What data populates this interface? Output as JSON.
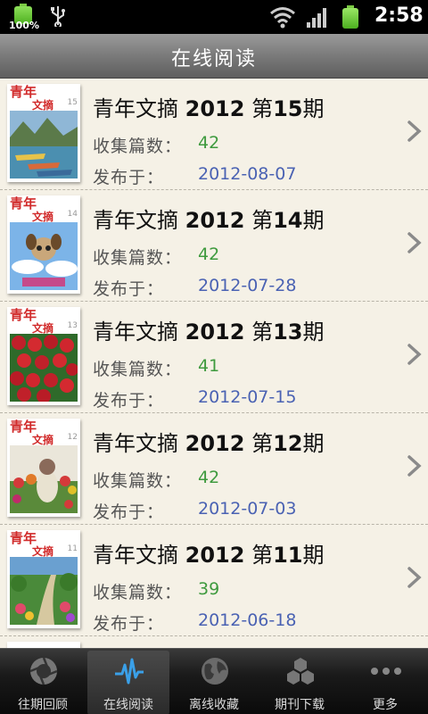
{
  "status_bar": {
    "battery_percent": "100%",
    "time": "2:58",
    "icons": [
      "battery-icon",
      "usb-icon",
      "wifi-icon",
      "signal-icon",
      "battery-icon"
    ]
  },
  "header": {
    "title": "在线阅读"
  },
  "list": {
    "count_label": "收集篇数：",
    "date_label": "发布于：",
    "items": [
      {
        "mag_name": "青年文摘",
        "year": "2012",
        "issue_prefix": "第",
        "issue": "15",
        "issue_suffix": "期",
        "count": "42",
        "date": "2012-08-07"
      },
      {
        "mag_name": "青年文摘",
        "year": "2012",
        "issue_prefix": "第",
        "issue": "14",
        "issue_suffix": "期",
        "count": "42",
        "date": "2012-07-28"
      },
      {
        "mag_name": "青年文摘",
        "year": "2012",
        "issue_prefix": "第",
        "issue": "13",
        "issue_suffix": "期",
        "count": "41",
        "date": "2012-07-15"
      },
      {
        "mag_name": "青年文摘",
        "year": "2012",
        "issue_prefix": "第",
        "issue": "12",
        "issue_suffix": "期",
        "count": "42",
        "date": "2012-07-03"
      },
      {
        "mag_name": "青年文摘",
        "year": "2012",
        "issue_prefix": "第",
        "issue": "11",
        "issue_suffix": "期",
        "count": "39",
        "date": "2012-06-18"
      }
    ],
    "cover_mast_1": "青年",
    "cover_mast_2": "文摘"
  },
  "tabs": [
    {
      "label": "往期回顾",
      "icon": "aperture-icon",
      "active": false
    },
    {
      "label": "在线阅读",
      "icon": "pulse-icon",
      "active": true
    },
    {
      "label": "离线收藏",
      "icon": "globe-icon",
      "active": false
    },
    {
      "label": "期刊下载",
      "icon": "hexagons-icon",
      "active": false
    },
    {
      "label": "更多",
      "icon": "more-icon",
      "active": false
    }
  ],
  "colors": {
    "count": "#3e9a3e",
    "date": "#4a62b3",
    "list_bg": "#f5f1e6",
    "accent_pulse": "#3aa0e8"
  }
}
